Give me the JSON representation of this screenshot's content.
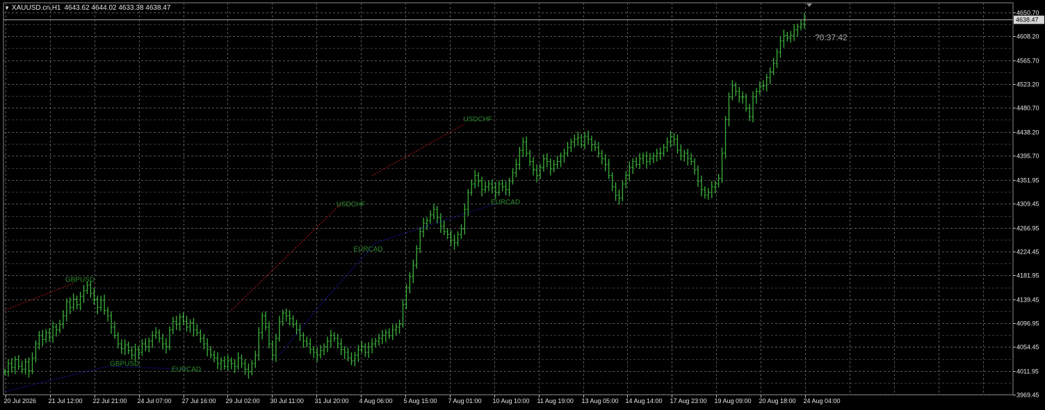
{
  "header": {
    "symbol_timeframe": "XAUUSD.cn,H1",
    "ohlc": "4643.62 4644.02 4633.38 4638.47"
  },
  "countdown": "?0:37:42",
  "colors": {
    "background": "#000000",
    "grid": "#5a5a5a",
    "candles": "#3cb43c",
    "axis_text": "#e6e6e6",
    "resistance_line": "#c01818",
    "support_line": "#1818b8",
    "pattern_label": "#2e8b2e",
    "price_line": "#a8a8a8"
  },
  "chart_data": {
    "type": "line",
    "title": "",
    "xlabel": "",
    "ylabel": "",
    "ylim": [
      3969.45,
      4668.0
    ],
    "y_ticks": [
      4650.7,
      4608.2,
      4565.7,
      4523.2,
      4480.7,
      4438.2,
      4395.7,
      4351.95,
      4309.45,
      4266.95,
      4224.45,
      4181.95,
      4139.45,
      4096.95,
      4054.45,
      4011.95,
      3969.45
    ],
    "x_tick_labels": [
      "20 Jul 2026",
      "21 Jul 12:00",
      "22 Jul 21:00",
      "24 Jul 07:00",
      "27 Jul 16:00",
      "29 Jul 02:00",
      "30 Jul 11:00",
      "31 Jul 20:00",
      "4 Aug 06:00",
      "5 Aug 15:00",
      "7 Aug 01:00",
      "10 Aug 10:00",
      "11 Aug 19:00",
      "13 Aug 05:00",
      "14 Aug 14:00",
      "17 Aug 23:00",
      "19 Aug 09:00",
      "20 Aug 18:00",
      "24 Aug 04:00"
    ],
    "current_price": 4638.47,
    "series": [
      {
        "values": [
          4010,
          4025,
          4018,
          4032,
          4020,
          4015,
          4028,
          4012,
          4035,
          4060,
          4075,
          4068,
          4080,
          4072,
          4090,
          4085,
          4095,
          4110,
          4135,
          4125,
          4140,
          4130,
          4145,
          4155,
          4165,
          4150,
          4140,
          4125,
          4138,
          4120,
          4110,
          4090,
          4075,
          4060,
          4052,
          4058,
          4048,
          4040,
          4050,
          4045,
          4060,
          4055,
          4065,
          4075,
          4080,
          4070,
          4060,
          4055,
          4085,
          4100,
          4095,
          4108,
          4100,
          4090,
          4098,
          4085,
          4080,
          4070,
          4060,
          4050,
          4040,
          4035,
          4025,
          4030,
          4020,
          4030,
          4025,
          4020,
          4035,
          4025,
          4015,
          4010,
          4025,
          4040,
          4080,
          4110,
          4090,
          4060,
          4040,
          4070,
          4100,
          4115,
          4110,
          4105,
          4095,
          4085,
          4075,
          4065,
          4060,
          4050,
          4045,
          4040,
          4048,
          4055,
          4065,
          4075,
          4070,
          4060,
          4050,
          4045,
          4035,
          4030,
          4040,
          4050,
          4055,
          4045,
          4055,
          4060,
          4065,
          4070,
          4075,
          4080,
          4075,
          4085,
          4090,
          4095,
          4130,
          4160,
          4180,
          4200,
          4230,
          4260,
          4275,
          4280,
          4290,
          4300,
          4285,
          4270,
          4260,
          4255,
          4245,
          4240,
          4255,
          4265,
          4300,
          4330,
          4345,
          4360,
          4350,
          4335,
          4340,
          4345,
          4338,
          4330,
          4345,
          4340,
          4335,
          4350,
          4365,
          4380,
          4405,
          4420,
          4400,
          4385,
          4370,
          4360,
          4375,
          4390,
          4385,
          4372,
          4380,
          4385,
          4395,
          4400,
          4410,
          4420,
          4425,
          4428,
          4415,
          4430,
          4425,
          4415,
          4410,
          4400,
          4390,
          4380,
          4360,
          4340,
          4325,
          4320,
          4345,
          4360,
          4375,
          4385,
          4380,
          4390,
          4395,
          4385,
          4390,
          4395,
          4400,
          4400,
          4410,
          4420,
          4430,
          4425,
          4405,
          4395,
          4400,
          4390,
          4385,
          4370,
          4350,
          4335,
          4325,
          4330,
          4340,
          4345,
          4355,
          4400,
          4460,
          4500,
          4520,
          4510,
          4500,
          4500,
          4480,
          4465,
          4500,
          4510,
          4520,
          4520,
          4535,
          4545,
          4560,
          4580,
          4600,
          4610,
          4605,
          4610,
          4620,
          4625,
          4630,
          4640
        ]
      }
    ],
    "annotations": [
      {
        "text": "GBPUSD",
        "x_index": 18,
        "y": 4166
      },
      {
        "text": "GBPUSD",
        "x_index": 31,
        "y": 4016
      },
      {
        "text": "EURCAD",
        "x_index": 49,
        "y": 4006
      },
      {
        "text": "USDCHF",
        "x_index": 97,
        "y": 4300
      },
      {
        "text": "EURCAD",
        "x_index": 102,
        "y": 4220
      },
      {
        "text": "USDCHF",
        "x_index": 134,
        "y": 4452
      },
      {
        "text": "EURCAD",
        "x_index": 142,
        "y": 4304
      }
    ],
    "trend_lines": [
      {
        "type": "resistance",
        "points": [
          [
            0,
            4120
          ],
          [
            20,
            4168
          ]
        ]
      },
      {
        "type": "resistance",
        "points": [
          [
            66,
            4120
          ],
          [
            98,
            4310
          ]
        ]
      },
      {
        "type": "resistance",
        "points": [
          [
            107,
            4360
          ],
          [
            134,
            4452
          ]
        ]
      },
      {
        "type": "support",
        "points": [
          [
            0,
            3975
          ],
          [
            30,
            4020
          ],
          [
            53,
            4015
          ]
        ]
      },
      {
        "type": "support",
        "points": [
          [
            80,
            4040
          ],
          [
            92,
            4130
          ],
          [
            108,
            4240
          ],
          [
            143,
            4310
          ]
        ]
      }
    ]
  }
}
